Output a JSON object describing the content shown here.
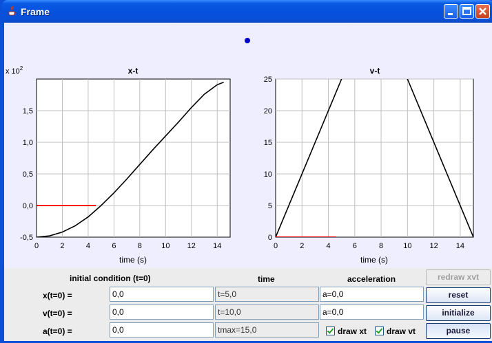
{
  "window": {
    "title": "Frame"
  },
  "colors": {
    "accent": "#0a50d8",
    "plot_line": "#000000",
    "marker_line": "#ff0000",
    "dot": "#0000cc"
  },
  "xt_plot": {
    "title": "x-t",
    "multiplier_base": "x 10",
    "multiplier_exp": "2",
    "xlabel": "time (s)",
    "xticks": [
      "0",
      "2",
      "4",
      "6",
      "8",
      "10",
      "12",
      "14"
    ],
    "yticks": [
      "-0,5",
      "0,0",
      "0,5",
      "1,0",
      "1,5"
    ]
  },
  "vt_plot": {
    "title": "v-t",
    "xlabel": "time (s)",
    "xticks": [
      "0",
      "2",
      "4",
      "6",
      "8",
      "10",
      "12",
      "14"
    ],
    "yticks": [
      "0",
      "5",
      "10",
      "15",
      "20",
      "25"
    ]
  },
  "chart_data": [
    {
      "type": "line",
      "title": "x-t",
      "xlabel": "time (s)",
      "ylabel": "",
      "y_multiplier": "x 10^2",
      "xlim": [
        0,
        15
      ],
      "ylim": [
        -0.5,
        2.0
      ],
      "grid": true,
      "series": [
        {
          "x": [
            0,
            1,
            2,
            3,
            4,
            5,
            6,
            7,
            8,
            9,
            10,
            11,
            12,
            13,
            14,
            14.5
          ],
          "y": [
            -0.5,
            -0.48,
            -0.42,
            -0.32,
            -0.18,
            0.0,
            0.2,
            0.42,
            0.65,
            0.88,
            1.1,
            1.32,
            1.55,
            1.76,
            1.91,
            1.95
          ]
        },
        {
          "x": [
            0,
            4.6
          ],
          "y": [
            0.0,
            0.0
          ]
        }
      ]
    },
    {
      "type": "line",
      "title": "v-t",
      "xlabel": "time (s)",
      "ylabel": "",
      "xlim": [
        0,
        15
      ],
      "ylim": [
        0,
        25
      ],
      "grid": true,
      "series": [
        {
          "x": [
            0,
            5
          ],
          "y": [
            0,
            25
          ]
        },
        {
          "x": [
            10,
            15
          ],
          "y": [
            25,
            0
          ]
        },
        {
          "x": [
            0,
            4.6
          ],
          "y": [
            0,
            0
          ]
        }
      ]
    }
  ],
  "controls": {
    "header_initial": "initial condition (t=0)",
    "header_time": "time",
    "header_acceleration": "acceleration",
    "rows": [
      {
        "label": "x(t=0) =",
        "init": "0,0",
        "time": "t=5,0",
        "accel": "a=0,0"
      },
      {
        "label": "v(t=0) =",
        "init": "0,0",
        "time": "t=10,0",
        "accel": "a=0,0"
      },
      {
        "label": "a(t=0) =",
        "init": "0,0",
        "time": "tmax=15,0"
      }
    ],
    "chk_xt": "draw xt",
    "chk_vt": "draw vt",
    "btn_redraw": "redraw xvt",
    "btn_reset": "reset",
    "btn_initialize": "initialize",
    "btn_pause": "pause"
  }
}
